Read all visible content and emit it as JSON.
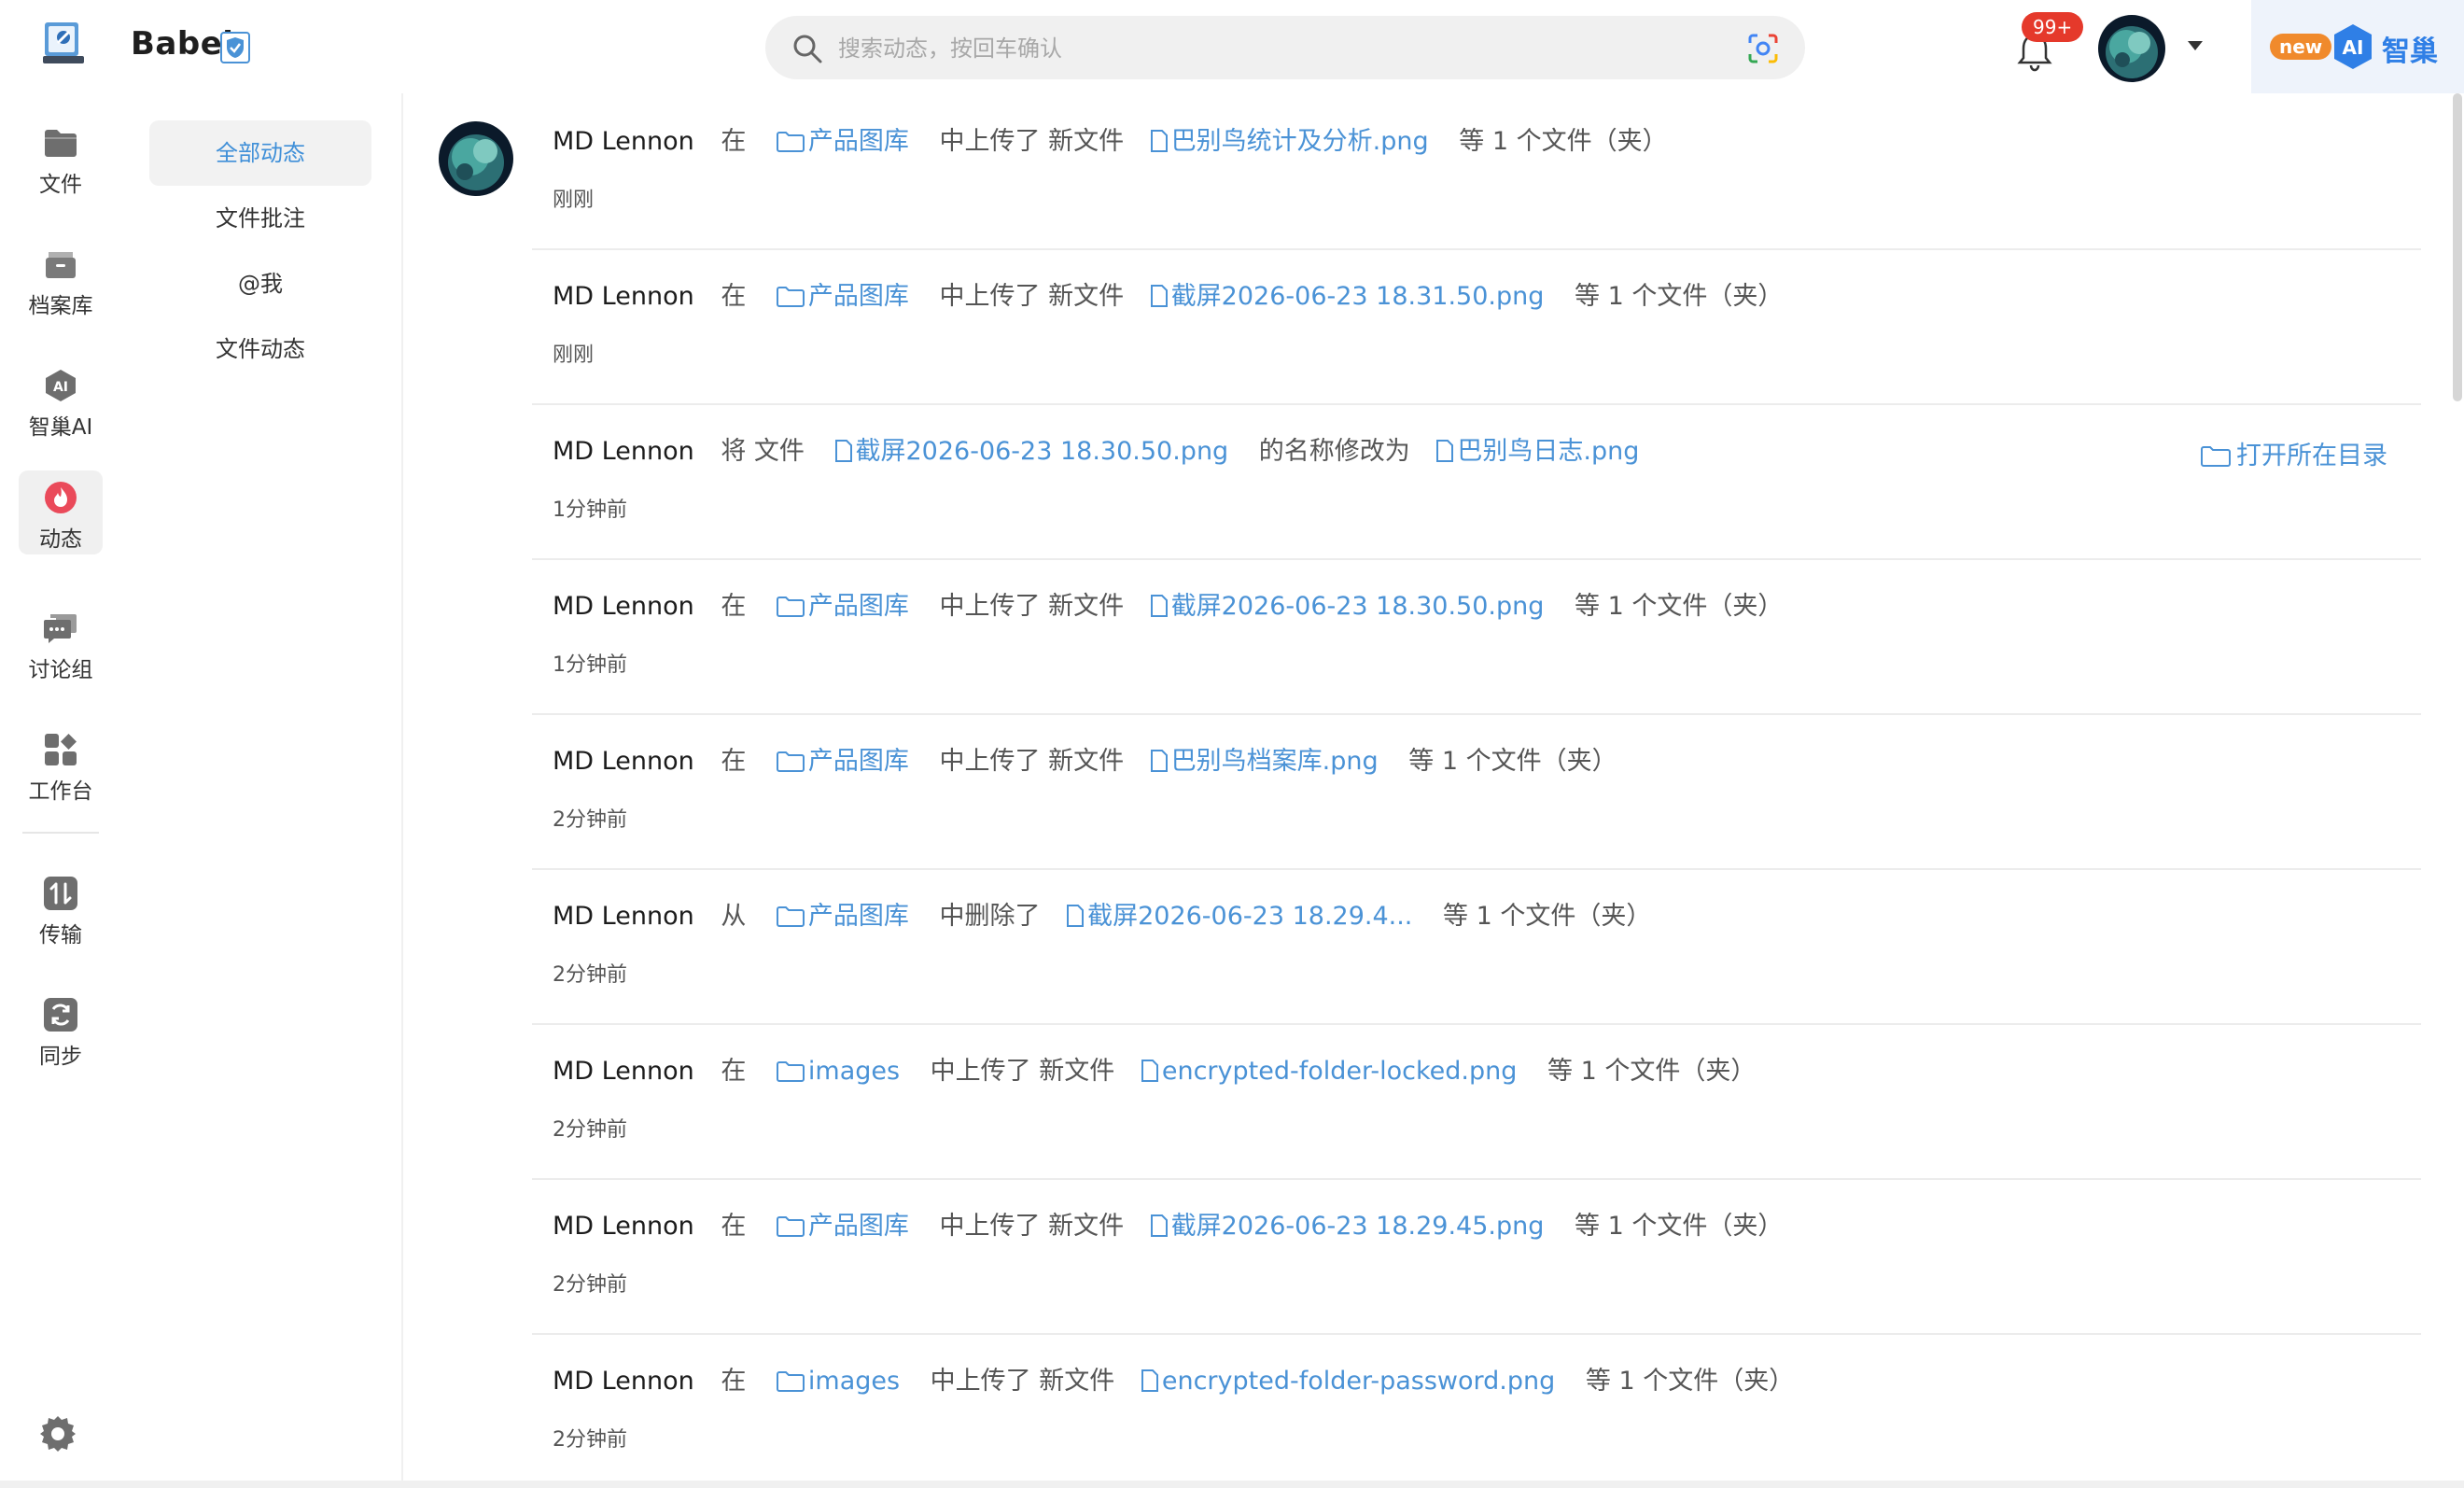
{
  "app": {
    "title": "Babel"
  },
  "header": {
    "search_placeholder": "搜索动态，按回车确认",
    "notification_count": "99+",
    "ai_new_badge": "new",
    "ai_logo_text": "AI",
    "ai_label": "智巢"
  },
  "left_nav": {
    "items": [
      {
        "label": "文件",
        "icon": "folder-icon"
      },
      {
        "label": "档案库",
        "icon": "archive-icon"
      },
      {
        "label": "智巢AI",
        "icon": "ai-icon"
      },
      {
        "label": "动态",
        "icon": "flame-icon"
      },
      {
        "label": "讨论组",
        "icon": "chat-icon"
      },
      {
        "label": "工作台",
        "icon": "apps-icon"
      },
      {
        "label": "传输",
        "icon": "transfer-icon"
      },
      {
        "label": "同步",
        "icon": "sync-icon"
      }
    ],
    "active": "动态"
  },
  "sub_nav": {
    "items": [
      "全部动态",
      "文件批注",
      "@我",
      "文件动态"
    ],
    "active": "全部动态"
  },
  "feed": {
    "open_dir_label": "打开所在目录",
    "rows": [
      {
        "actor": "MD Lennon",
        "verb": "在",
        "folder": "产品图库",
        "action": "中上传了 新文件",
        "file": "巴别鸟统计及分析.png",
        "suffix": "等 1 个文件（夹）",
        "time": "刚刚"
      },
      {
        "actor": "MD Lennon",
        "verb": "在",
        "folder": "产品图库",
        "action": "中上传了 新文件",
        "file": "截屏2026-06-23 18.31.50.png",
        "suffix": "等 1 个文件（夹）",
        "time": "刚刚"
      },
      {
        "actor": "MD Lennon",
        "verb": "将 文件",
        "file": "截屏2026-06-23 18.30.50.png",
        "action": "的名称修改为",
        "file2": "巴别鸟日志.png",
        "time": "1分钟前"
      },
      {
        "actor": "MD Lennon",
        "verb": "在",
        "folder": "产品图库",
        "action": "中上传了 新文件",
        "file": "截屏2026-06-23 18.30.50.png",
        "suffix": "等 1 个文件（夹）",
        "time": "1分钟前"
      },
      {
        "actor": "MD Lennon",
        "verb": "在",
        "folder": "产品图库",
        "action": "中上传了 新文件",
        "file": "巴别鸟档案库.png",
        "suffix": "等 1 个文件（夹）",
        "time": "2分钟前"
      },
      {
        "actor": "MD Lennon",
        "verb": "从",
        "folder": "产品图库",
        "action": "中删除了",
        "file": "截屏2026-06-23 18.29.4...",
        "suffix": "等 1 个文件（夹）",
        "time": "2分钟前"
      },
      {
        "actor": "MD Lennon",
        "verb": "在",
        "folder": "images",
        "action": "中上传了 新文件",
        "file": "encrypted-folder-locked.png",
        "suffix": "等 1 个文件（夹）",
        "time": "2分钟前"
      },
      {
        "actor": "MD Lennon",
        "verb": "在",
        "folder": "产品图库",
        "action": "中上传了 新文件",
        "file": "截屏2026-06-23 18.29.45.png",
        "suffix": "等 1 个文件（夹）",
        "time": "2分钟前"
      },
      {
        "actor": "MD Lennon",
        "verb": "在",
        "folder": "images",
        "action": "中上传了 新文件",
        "file": "encrypted-folder-password.png",
        "suffix": "等 1 个文件（夹）",
        "time": "2分钟前"
      }
    ]
  },
  "colors": {
    "accent": "#4a92d6",
    "badge_red": "#e5392b",
    "new_orange": "#f08a2c",
    "ai_blue": "#2f7fe6"
  }
}
